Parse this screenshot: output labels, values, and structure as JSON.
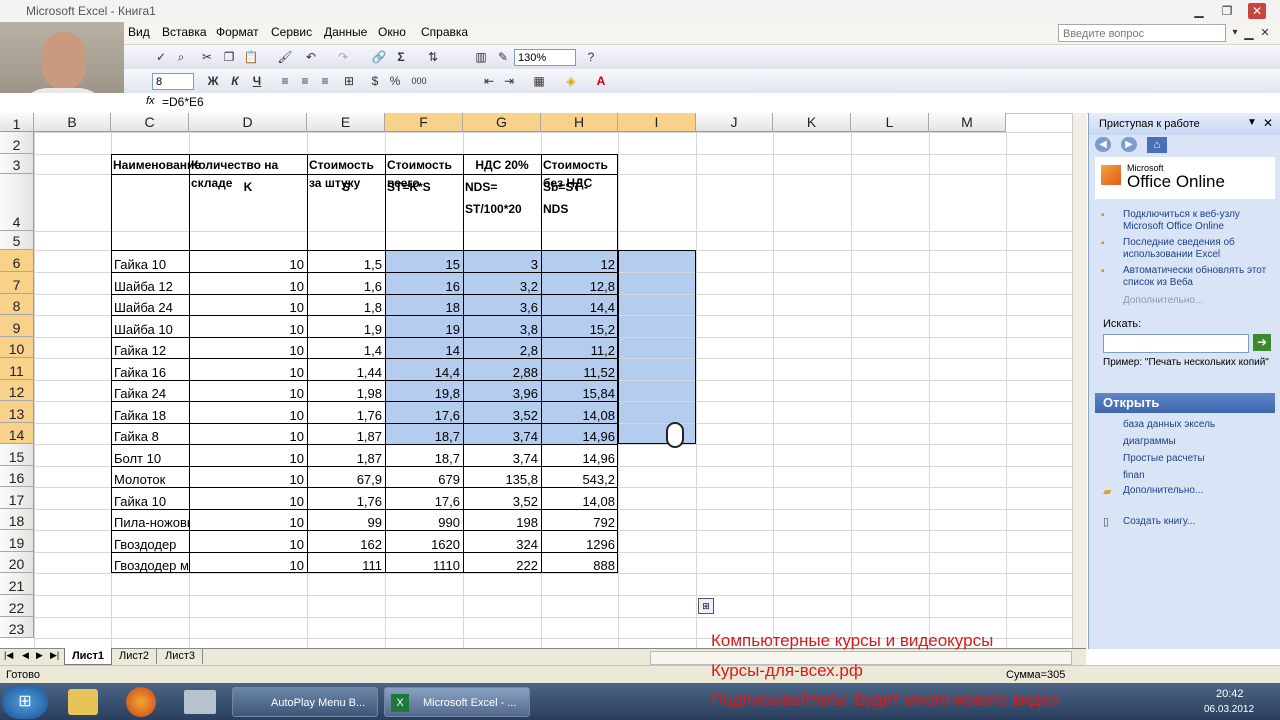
{
  "window": {
    "title": "Microsoft Excel - Книга1",
    "help_placeholder": "Введите вопрос"
  },
  "menu": [
    "Вид",
    "Вставка",
    "Формат",
    "Сервис",
    "Данные",
    "Окно",
    "Справка"
  ],
  "toolbar": {
    "zoom": "130%",
    "font_size": "8"
  },
  "formula_bar": {
    "fx": "fx",
    "formula": "=D6*E6"
  },
  "columns": [
    "B",
    "C",
    "D",
    "E",
    "F",
    "G",
    "H",
    "I",
    "J",
    "K",
    "L",
    "M"
  ],
  "rows": [
    "1",
    "2",
    "3",
    "4",
    "5",
    "6",
    "7",
    "8",
    "9",
    "10",
    "11",
    "12",
    "13",
    "14",
    "15",
    "16",
    "17",
    "18",
    "19",
    "20",
    "21",
    "22",
    "23"
  ],
  "table": {
    "headers": {
      "name": "Наименование",
      "qty": "Количество на складе",
      "price": "Стоимость за штуку",
      "total": "Стоимость всего",
      "vat": "НДС 20%",
      "novat": "Стоимость без НДС"
    },
    "codes": {
      "qty": "K",
      "price": "S",
      "total": "ST=K*S",
      "vat": "NDS= ST/100*20",
      "novat": "Sb=ST - NDS"
    },
    "rows": [
      {
        "name": "Гайка 10",
        "qty": "10",
        "price": "1,5",
        "total": "15",
        "vat": "3",
        "novat": "12"
      },
      {
        "name": "Шайба 12",
        "qty": "10",
        "price": "1,6",
        "total": "16",
        "vat": "3,2",
        "novat": "12,8"
      },
      {
        "name": "Шайба 24",
        "qty": "10",
        "price": "1,8",
        "total": "18",
        "vat": "3,6",
        "novat": "14,4"
      },
      {
        "name": "Шайба 10",
        "qty": "10",
        "price": "1,9",
        "total": "19",
        "vat": "3,8",
        "novat": "15,2"
      },
      {
        "name": "Гайка 12",
        "qty": "10",
        "price": "1,4",
        "total": "14",
        "vat": "2,8",
        "novat": "11,2"
      },
      {
        "name": "Гайка 16",
        "qty": "10",
        "price": "1,44",
        "total": "14,4",
        "vat": "2,88",
        "novat": "11,52"
      },
      {
        "name": "Гайка 24",
        "qty": "10",
        "price": "1,98",
        "total": "19,8",
        "vat": "3,96",
        "novat": "15,84"
      },
      {
        "name": "Гайка 18",
        "qty": "10",
        "price": "1,76",
        "total": "17,6",
        "vat": "3,52",
        "novat": "14,08"
      },
      {
        "name": "Гайка 8",
        "qty": "10",
        "price": "1,87",
        "total": "18,7",
        "vat": "3,74",
        "novat": "14,96"
      },
      {
        "name": "Болт 10",
        "qty": "10",
        "price": "1,87",
        "total": "18,7",
        "vat": "3,74",
        "novat": "14,96"
      },
      {
        "name": "Молоток",
        "qty": "10",
        "price": "67,9",
        "total": "679",
        "vat": "135,8",
        "novat": "543,2"
      },
      {
        "name": "Гайка 10",
        "qty": "10",
        "price": "1,76",
        "total": "17,6",
        "vat": "3,52",
        "novat": "14,08"
      },
      {
        "name": "Пила-ножовка",
        "qty": "10",
        "price": "99",
        "total": "990",
        "vat": "198",
        "novat": "792"
      },
      {
        "name": "Гвоздодер",
        "qty": "10",
        "price": "162",
        "total": "1620",
        "vat": "324",
        "novat": "1296"
      },
      {
        "name": "Гвоздодер малый",
        "qty": "10",
        "price": "111",
        "total": "1110",
        "vat": "222",
        "novat": "888"
      }
    ]
  },
  "pane": {
    "title": "Приступая к работе",
    "brand": "Office Online",
    "brand_small": "Microsoft",
    "links": [
      "Подключиться к веб-узлу Microsoft Office Online",
      "Последние сведения об использовании Excel",
      "Автоматически обновлять этот список из Веба"
    ],
    "more": "Дополнительно...",
    "search_label": "Искать:",
    "example": "Пример: \"Печать нескольких копий\"",
    "open_title": "Открыть",
    "files": [
      "база данных эксель",
      "диаграммы",
      "Простые расчеты",
      "finan"
    ],
    "open_more": "Дополнительно...",
    "create": "Создать книгу..."
  },
  "sheets": [
    "Лист1",
    "Лист2",
    "Лист3"
  ],
  "status": {
    "ready": "Готово",
    "sum": "Сумма=305"
  },
  "overlay": [
    "Компьютерные курсы и видеокурсы",
    "Курсы-для-всех.рф",
    "Подписывайтель! Будет много нового видео"
  ],
  "taskbar": {
    "task1": "AutoPlay Menu B...",
    "task2": "Microsoft Excel - ...",
    "time": "20:42",
    "date": "06.03.2012"
  }
}
